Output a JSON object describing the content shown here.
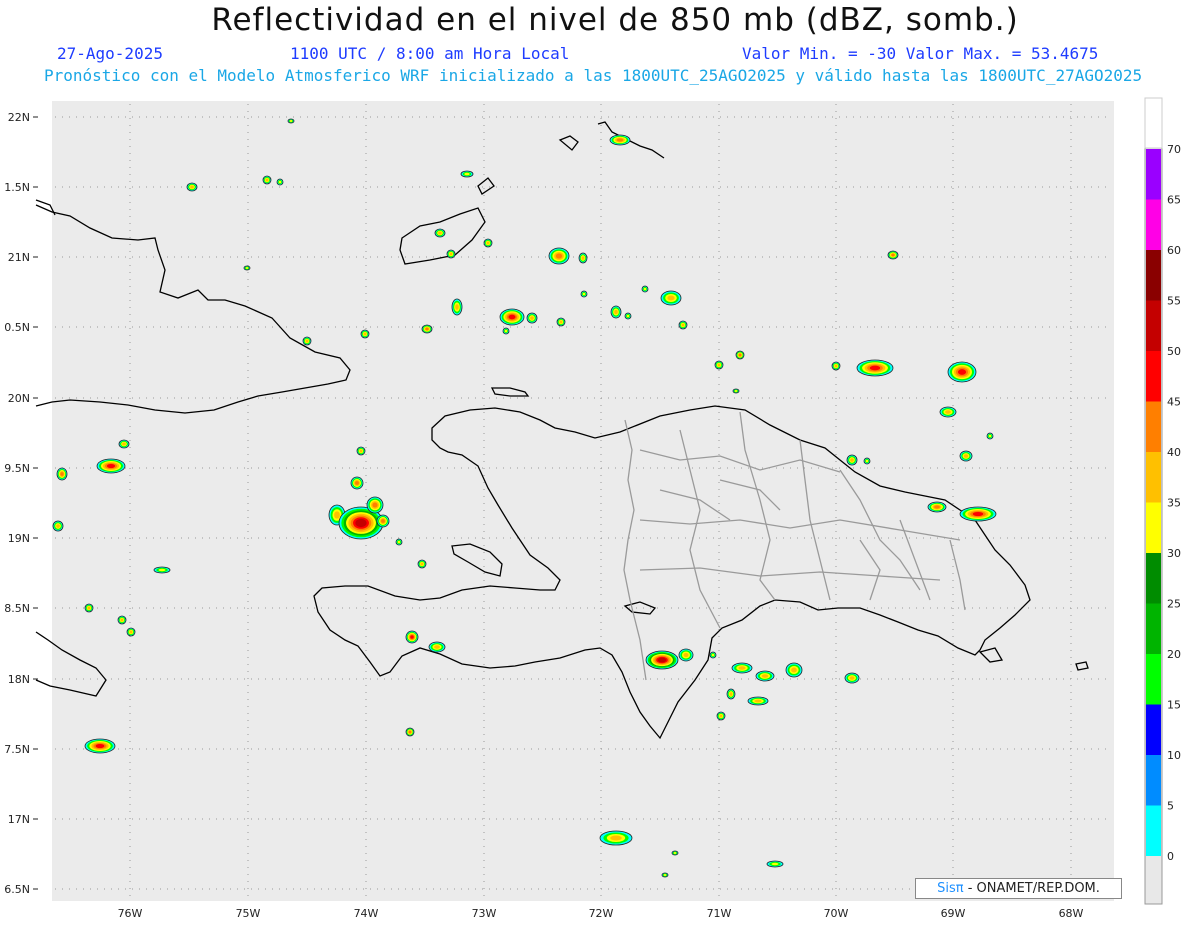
{
  "header": {
    "title": "Reflectividad en el nivel de 850 mb (dBZ, somb.)",
    "date": "27-Ago-2025",
    "time": "1100 UTC / 8:00 am Hora Local",
    "minmax": "Valor Min. = -30  Valor Max. = 53.4675",
    "forecast": "Pronóstico con el Modelo Atmosferico WRF inicializado a las 1800UTC_25AGO2025 y válido hasta las  1800UTC_27AGO2025"
  },
  "map": {
    "background": "#ebebeb",
    "lat_labels": [
      "22N",
      "1.5N",
      "21N",
      "0.5N",
      "20N",
      "9.5N",
      "19N",
      "8.5N",
      "18N",
      "7.5N",
      "17N",
      "6.5N"
    ],
    "lon_labels": [
      "76W",
      "75W",
      "74W",
      "73W",
      "72W",
      "71W",
      "70W",
      "69W",
      "68W"
    ]
  },
  "colorbar": {
    "labels": [
      "70",
      "65",
      "60",
      "55",
      "50",
      "45",
      "40",
      "35",
      "30",
      "25",
      "20",
      "15",
      "10",
      "5",
      "0"
    ],
    "colors": [
      "#9a00ff",
      "#ff00e6",
      "#8a0000",
      "#c40000",
      "#ff0000",
      "#ff7f00",
      "#ffc000",
      "#ffff00",
      "#008c00",
      "#00b400",
      "#00ff00",
      "#0000ff",
      "#008cff",
      "#00ffff"
    ]
  },
  "credit": {
    "brand": "Sisπ",
    "text": " - ONAMET/REP.DOM."
  }
}
